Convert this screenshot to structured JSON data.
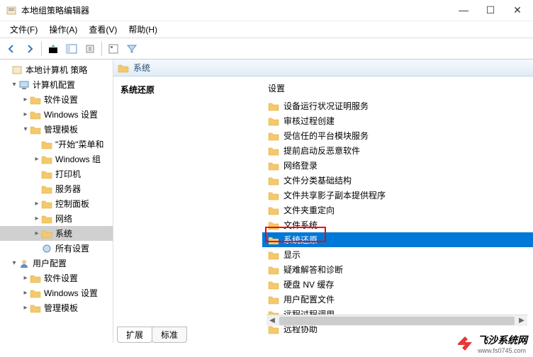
{
  "window": {
    "title": "本地组策略编辑器"
  },
  "menu": {
    "file": "文件(F)",
    "action": "操作(A)",
    "view": "查看(V)",
    "help": "帮助(H)"
  },
  "tree": {
    "root": "本地计算机 策略",
    "computer_config": "计算机配置",
    "software_settings": "软件设置",
    "windows_settings": "Windows 设置",
    "admin_templates": "管理模板",
    "start_menu": "\"开始\"菜单和",
    "windows_components": "Windows 组",
    "printers": "打印机",
    "server": "服务器",
    "control_panel": "控制面板",
    "network": "网络",
    "system": "系统",
    "all_settings": "所有设置",
    "user_config": "用户配置",
    "u_software": "软件设置",
    "u_windows": "Windows 设置",
    "u_admin": "管理模板"
  },
  "header": {
    "title": "系统"
  },
  "section": {
    "title": "系统还原"
  },
  "settings_label": "设置",
  "items": {
    "i0": "设备运行状况证明服务",
    "i1": "审核过程创建",
    "i2": "受信任的平台模块服务",
    "i3": "提前启动反恶意软件",
    "i4": "网络登录",
    "i5": "文件分类基础结构",
    "i6": "文件共享影子副本提供程序",
    "i7": "文件夹重定向",
    "i8": "文件系统",
    "i9": "系统还原",
    "i10": "显示",
    "i11": "疑难解答和诊断",
    "i12": "硬盘 NV 缓存",
    "i13": "用户配置文件",
    "i14": "远程过程调用",
    "i15": "远程协助"
  },
  "tabs": {
    "extended": "扩展",
    "standard": "标准"
  },
  "watermark": {
    "text": "飞沙系统网",
    "sub": "www.fs0745.com"
  }
}
